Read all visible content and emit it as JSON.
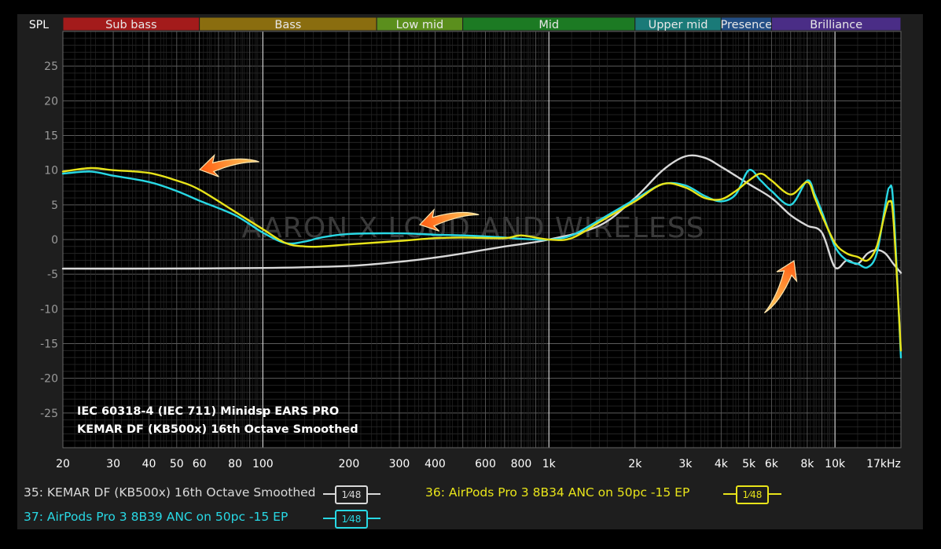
{
  "chart_data": {
    "type": "line",
    "ylabel": "SPL",
    "xunit": "kHz",
    "x_scale": "log",
    "xlim": [
      20,
      17000
    ],
    "ylim": [
      -30,
      30
    ],
    "grid": true,
    "yticks": [
      25,
      20,
      15,
      10,
      5,
      0,
      -5,
      -10,
      -15,
      -20,
      -25
    ],
    "xticks": [
      {
        "v": 20,
        "label": "20"
      },
      {
        "v": 30,
        "label": "30"
      },
      {
        "v": 40,
        "label": "40"
      },
      {
        "v": 50,
        "label": "50"
      },
      {
        "v": 60,
        "label": "60"
      },
      {
        "v": 80,
        "label": "80"
      },
      {
        "v": 100,
        "label": "100"
      },
      {
        "v": 200,
        "label": "200"
      },
      {
        "v": 300,
        "label": "300"
      },
      {
        "v": 400,
        "label": "400"
      },
      {
        "v": 600,
        "label": "600"
      },
      {
        "v": 800,
        "label": "800"
      },
      {
        "v": 1000,
        "label": "1k"
      },
      {
        "v": 2000,
        "label": "2k"
      },
      {
        "v": 3000,
        "label": "3k"
      },
      {
        "v": 4000,
        "label": "4k"
      },
      {
        "v": 5000,
        "label": "5k"
      },
      {
        "v": 6000,
        "label": "6k"
      },
      {
        "v": 8000,
        "label": "8k"
      },
      {
        "v": 10000,
        "label": "10k"
      },
      {
        "v": 17000,
        "label": "17kHz"
      }
    ],
    "bands": [
      {
        "name": "Sub bass",
        "from": 20,
        "to": 60,
        "color": "#a31b1b"
      },
      {
        "name": "Bass",
        "from": 60,
        "to": 250,
        "color": "#8a6d0f"
      },
      {
        "name": "Low mid",
        "from": 250,
        "to": 500,
        "color": "#5b8f1d"
      },
      {
        "name": "Mid",
        "from": 500,
        "to": 2000,
        "color": "#1c7a23"
      },
      {
        "name": "Upper mid",
        "from": 2000,
        "to": 4000,
        "color": "#1a7a78"
      },
      {
        "name": "Presence",
        "from": 4000,
        "to": 6000,
        "color": "#234f86"
      },
      {
        "name": "Brilliance",
        "from": 6000,
        "to": 17000,
        "color": "#4a2d86"
      }
    ],
    "watermark": "AARON X LOUD AND WIRELESS",
    "annotation": [
      "IEC 60318-4 (IEC 711) Minidsp EARS PRO",
      "KEMAR DF (KB500x) 16th Octave Smoothed"
    ],
    "series": [
      {
        "name": "35: KEMAR DF (KB500x) 16th Octave Smoothed",
        "color": "#d9d9d9",
        "badge": "1⁄48",
        "x": [
          20,
          40,
          100,
          200,
          300,
          400,
          500,
          700,
          1000,
          1500,
          2000,
          2500,
          3000,
          3500,
          4000,
          5000,
          6000,
          7000,
          8000,
          9000,
          10000,
          11000,
          12000,
          13000,
          14000,
          15000,
          16000,
          17000
        ],
        "y": [
          -4.2,
          -4.2,
          -4.1,
          -3.8,
          -3.2,
          -2.6,
          -2.0,
          -1.0,
          0,
          2.0,
          6.0,
          10.0,
          12.0,
          11.8,
          10.5,
          8.0,
          6.0,
          3.5,
          2.0,
          1.0,
          -4.0,
          -3.0,
          -3.5,
          -2.0,
          -1.5,
          -2.0,
          -3.5,
          -4.8
        ]
      },
      {
        "name": "36: AirPods Pro 3 8B34 ANC on 50pc -15 EP",
        "color": "#e8e41a",
        "badge": "1⁄48",
        "x": [
          20,
          25,
          30,
          40,
          50,
          60,
          80,
          100,
          120,
          140,
          160,
          200,
          300,
          400,
          500,
          700,
          800,
          1000,
          1200,
          1500,
          2000,
          2500,
          3000,
          3500,
          4000,
          4500,
          5000,
          5500,
          6000,
          7000,
          8000,
          8500,
          9000,
          10000,
          11000,
          12000,
          13000,
          14000,
          15000,
          15500,
          16000,
          17000
        ],
        "y": [
          9.8,
          10.3,
          10.0,
          9.6,
          8.5,
          7.2,
          4.0,
          1.5,
          -0.5,
          -1.0,
          -1.0,
          -0.7,
          -0.2,
          0.2,
          0.3,
          0.2,
          0.6,
          0.0,
          0.2,
          2.5,
          5.5,
          8.0,
          7.5,
          6.0,
          5.8,
          7.0,
          8.5,
          9.5,
          8.5,
          6.5,
          8.3,
          6.0,
          3.5,
          -0.5,
          -2.0,
          -2.5,
          -3.0,
          -1.0,
          4.0,
          5.5,
          3.0,
          -16.0
        ]
      },
      {
        "name": "37: AirPods Pro 3 8B39 ANC on 50pc -15 EP",
        "color": "#28d8e4",
        "badge": "1⁄48",
        "x": [
          20,
          25,
          30,
          40,
          50,
          60,
          80,
          100,
          120,
          140,
          160,
          200,
          300,
          400,
          500,
          700,
          800,
          1000,
          1200,
          1500,
          2000,
          2500,
          3000,
          3500,
          4000,
          4500,
          5000,
          5500,
          6000,
          7000,
          8000,
          8500,
          9000,
          10000,
          11000,
          12000,
          13000,
          14000,
          15000,
          15500,
          16000,
          17000
        ],
        "y": [
          9.5,
          9.8,
          9.2,
          8.3,
          7.0,
          5.6,
          3.5,
          1.0,
          -0.5,
          -0.3,
          0.3,
          0.8,
          0.9,
          0.7,
          0.6,
          0.3,
          0.1,
          0.0,
          0.6,
          2.8,
          5.8,
          8.0,
          7.8,
          6.3,
          5.5,
          6.5,
          10.0,
          8.5,
          7.0,
          5.0,
          8.5,
          6.5,
          4.0,
          -1.0,
          -3.0,
          -3.5,
          -4.0,
          -2.0,
          5.0,
          7.5,
          5.0,
          -17.0
        ]
      }
    ]
  }
}
